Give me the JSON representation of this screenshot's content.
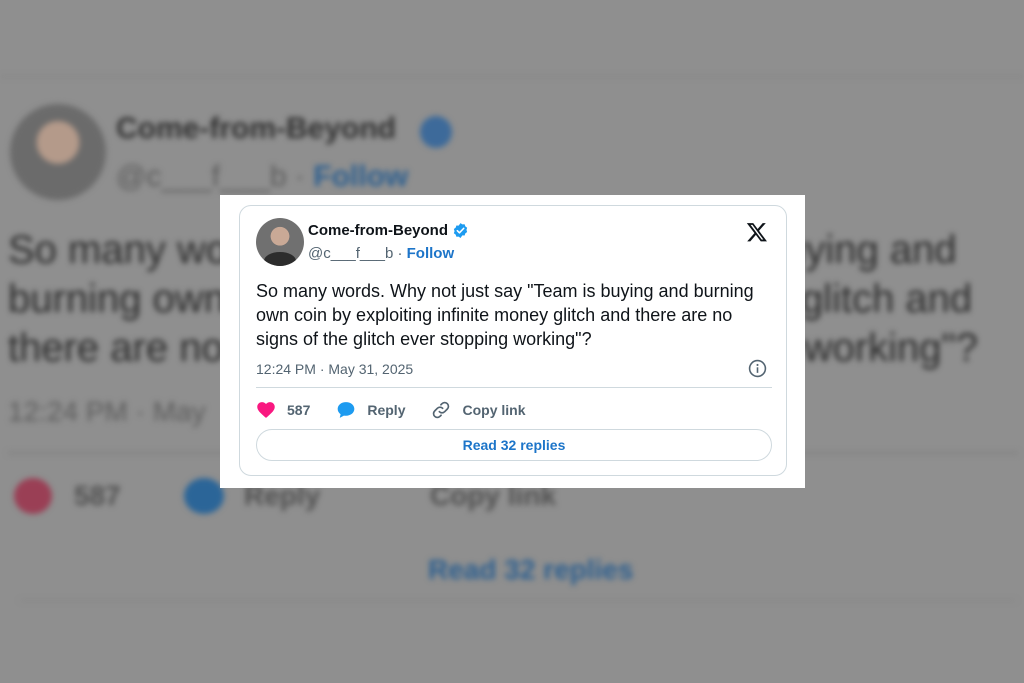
{
  "tweet": {
    "author_name": "Come-from-Beyond",
    "handle": "@c___f___b",
    "separator": "·",
    "follow_label": "Follow",
    "text": "So many words. Why not just say \"Team is buying and burning own coin by exploiting infinite money glitch and there are no signs of the glitch ever stopping working\"?",
    "timestamp": "12:24 PM · May 31, 2025",
    "like_count": "587",
    "reply_label": "Reply",
    "copy_link_label": "Copy link",
    "read_replies_label": "Read 32 replies"
  },
  "background": {
    "author_name": "Come-from-Beyond",
    "handle": "@c___f___b",
    "follow_label": "Follow",
    "text_fragment": "So many wo                                                    uying and burning own                                                  glitch and there are no                                                  working\"?",
    "timestamp_fragment": "12:24 PM · May",
    "like_count": "587",
    "reply_label": "Reply",
    "copy_link_label": "Copy link",
    "read_replies_label": "Read 32 replies"
  },
  "icons": {
    "verified": "verified-badge-icon",
    "logo": "x-logo-icon",
    "info": "info-icon",
    "like": "heart-icon",
    "reply": "speech-bubble-icon",
    "copy": "link-icon"
  },
  "colors": {
    "accent": "#1d75c9",
    "heart": "#f91880",
    "verified": "#1d9bf0",
    "text": "#0f1419",
    "muted": "#536471"
  }
}
